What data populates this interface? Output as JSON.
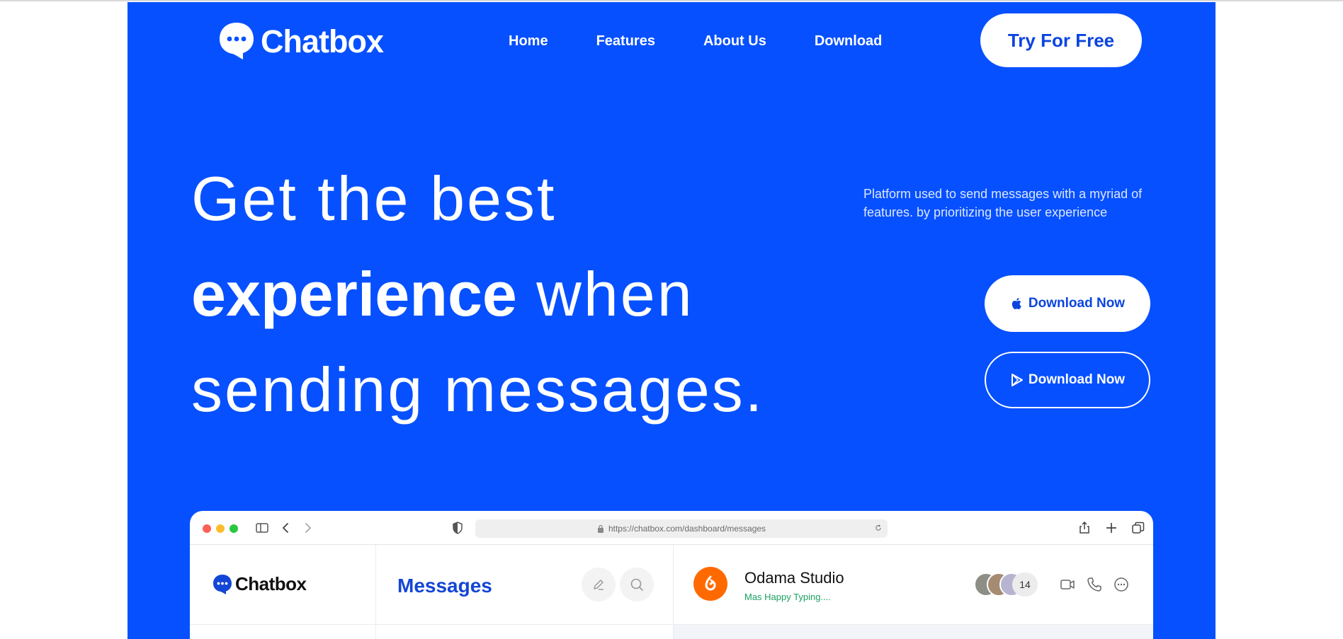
{
  "brand": {
    "name": "Chatbox"
  },
  "nav": {
    "links": [
      "Home",
      "Features",
      "About Us",
      "Download"
    ],
    "cta": "Try For Free"
  },
  "hero": {
    "line1": "Get the best",
    "line2_bold": "experience",
    "line2_rest": " when",
    "line3": "sending messages.",
    "tagline": "Platform used to send messages with a myriad of features. by prioritizing the user experience",
    "download_ios": "Download Now",
    "download_android": "Download Now"
  },
  "browser": {
    "url": "https://chatbox.com/dashboard/messages"
  },
  "app": {
    "logo": "Chatbox",
    "messages_title": "Messages",
    "chat": {
      "name": "Odama Studio",
      "status": "Mas Happy Typing....",
      "member_count": "14"
    }
  },
  "colors": {
    "hero_bg": "#0650ff",
    "accent_text": "#0b44e0",
    "studio_orange": "#ff6a00",
    "typing_green": "#19a15f"
  },
  "icons": [
    "chat-bubble-icon",
    "apple-icon",
    "play-store-icon",
    "sidebar-toggle-icon",
    "back-icon",
    "forward-icon",
    "shield-icon",
    "lock-icon",
    "refresh-icon",
    "share-icon",
    "plus-icon",
    "tabs-icon",
    "edit-icon",
    "search-icon",
    "video-icon",
    "phone-icon",
    "more-icon"
  ]
}
